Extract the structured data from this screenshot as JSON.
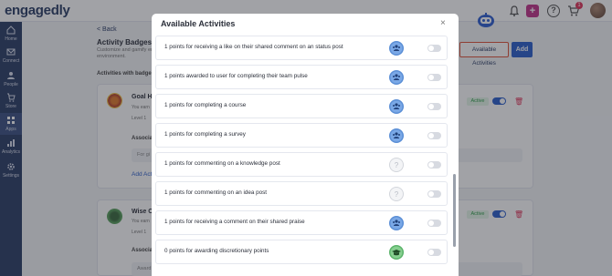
{
  "app": {
    "logo_text": "engagedly"
  },
  "sidebar": {
    "items": [
      {
        "label": "Home",
        "icon": "home-icon"
      },
      {
        "label": "Connect",
        "icon": "mail-icon"
      },
      {
        "label": "People",
        "icon": "people-icon"
      },
      {
        "label": "Store",
        "icon": "cart-icon"
      },
      {
        "label": "Apps",
        "icon": "apps-icon"
      },
      {
        "label": "Analytics",
        "icon": "analytics-icon"
      },
      {
        "label": "Settings",
        "icon": "gear-icon"
      }
    ]
  },
  "topbar": {
    "plus_label": "+",
    "help_label": "?",
    "cart_badge": "1"
  },
  "page": {
    "back_label": "< Back",
    "title": "Activity Badges",
    "subtitle": "Customize and gamify em... environment.",
    "section_label": "Activities with badge",
    "available_button": "Available Activities",
    "add_button": "Add",
    "cards": [
      {
        "name": "Goal Hu",
        "line1": "You earn",
        "line2": "Level 1",
        "status": "Active",
        "assoc_label": "Associat",
        "input_text": "For gi",
        "add_link": "Add Activ"
      },
      {
        "name": "Wise Ow",
        "line1": "You earn",
        "line2": "Level 1",
        "status": "Active",
        "assoc_label": "Associat",
        "input_text": "Award course specific points to the user for completing that course"
      }
    ]
  },
  "modal": {
    "title": "Available Activities",
    "close_label": "×",
    "activities": [
      {
        "text": "1 points for receiving a like on their shared comment on an status post",
        "icon": "people-icon",
        "icon_color": "#5b8fd6"
      },
      {
        "text": "1 points awarded to user for completing their team pulse",
        "icon": "people-icon",
        "icon_color": "#5b8fd6"
      },
      {
        "text": "1 points for completing a course",
        "icon": "people-icon",
        "icon_color": "#5b8fd6"
      },
      {
        "text": "1 points for completing a survey",
        "icon": "people-icon",
        "icon_color": "#5b8fd6"
      },
      {
        "text": "1 points for commenting on a knowledge post",
        "icon": "question-icon",
        "icon_color": "#e7e8ec"
      },
      {
        "text": "1 points for commenting on an idea post",
        "icon": "question-icon",
        "icon_color": "#e7e8ec"
      },
      {
        "text": "1 points for receiving a comment on their shared praise",
        "icon": "people-icon",
        "icon_color": "#5b8fd6"
      },
      {
        "text": "0 points for awarding discretionary points",
        "icon": "graduation-cap-icon",
        "icon_color": "#5bb36a"
      }
    ]
  },
  "colors": {
    "brand_navy": "#2c3e66",
    "primary_blue": "#2c5fcc",
    "highlight_border": "#e0533a",
    "active_green": "#2e9e49"
  }
}
